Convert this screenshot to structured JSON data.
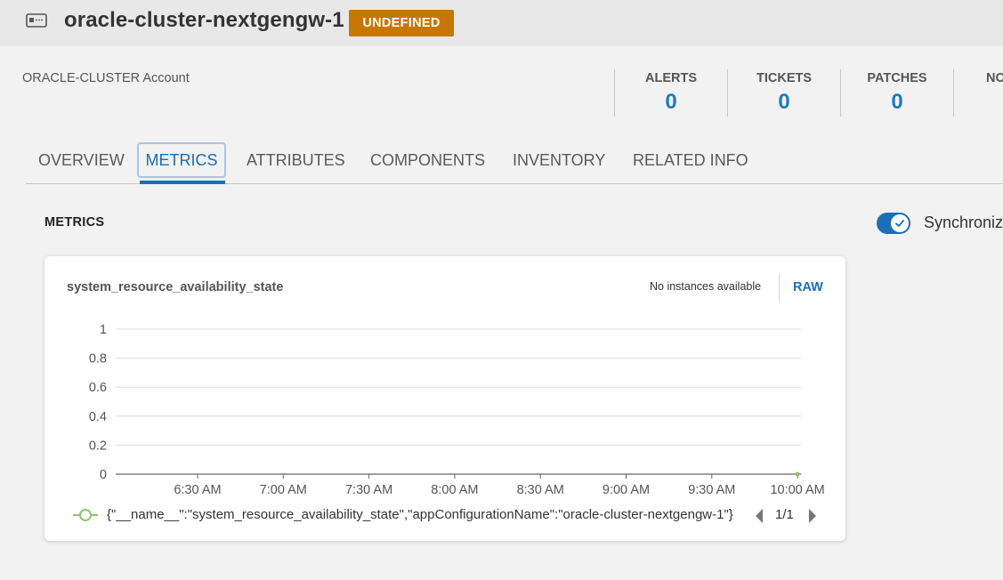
{
  "header": {
    "title": "oracle-cluster-nextgengw-1",
    "status": "UNDEFINED",
    "status_color": "#c77700"
  },
  "summary": {
    "account": "ORACLE-CLUSTER Account",
    "stats": [
      {
        "label": "ALERTS",
        "value": "0"
      },
      {
        "label": "TICKETS",
        "value": "0"
      },
      {
        "label": "PATCHES",
        "value": "0"
      },
      {
        "label": "NO",
        "value": ""
      }
    ]
  },
  "tabs": [
    {
      "label": "OVERVIEW",
      "active": false
    },
    {
      "label": "METRICS",
      "active": true
    },
    {
      "label": "ATTRIBUTES",
      "active": false
    },
    {
      "label": "COMPONENTS",
      "active": false
    },
    {
      "label": "INVENTORY",
      "active": false
    },
    {
      "label": "RELATED INFO",
      "active": false
    }
  ],
  "metrics": {
    "section_title": "METRICS",
    "sync_label": "Synchronize",
    "sync_enabled": true,
    "card": {
      "title": "system_resource_availability_state",
      "no_instances": "No instances available",
      "raw_label": "RAW",
      "legend_text": "{\"__name__\":\"system_resource_availability_state\",\"appConfigurationName\":\"oracle-cluster-nextgengw-1\"}",
      "pager": "1/1"
    }
  },
  "colors": {
    "accent": "#1a6fb5",
    "value_blue": "#1a7bc4",
    "series_green": "#8cc76b"
  },
  "chart_data": {
    "type": "line",
    "title": "system_resource_availability_state",
    "xlabel": "",
    "ylabel": "",
    "ylim": [
      0,
      1
    ],
    "yticks": [
      "1",
      "0.8",
      "0.6",
      "0.4",
      "0.2",
      "0"
    ],
    "xticks": [
      "6:30 AM",
      "7:00 AM",
      "7:30 AM",
      "8:00 AM",
      "8:30 AM",
      "9:00 AM",
      "9:30 AM",
      "10:00 AM"
    ],
    "grid": true,
    "series": [
      {
        "values": [
          {
            "x": "10:00 AM",
            "y": 0
          }
        ]
      }
    ]
  }
}
